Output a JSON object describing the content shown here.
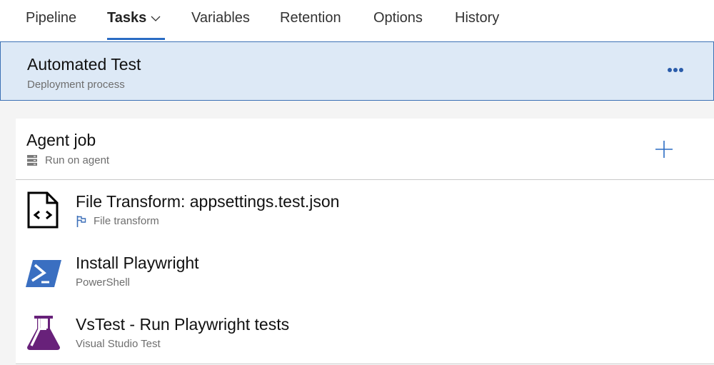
{
  "tabs": [
    {
      "label": "Pipeline",
      "active": false
    },
    {
      "label": "Tasks",
      "active": true,
      "has_dropdown": true
    },
    {
      "label": "Variables",
      "active": false
    },
    {
      "label": "Retention",
      "active": false
    },
    {
      "label": "Options",
      "active": false
    },
    {
      "label": "History",
      "active": false
    }
  ],
  "stage": {
    "title": "Automated Test",
    "subtitle": "Deployment process",
    "more_icon": "ellipsis-icon"
  },
  "job": {
    "title": "Agent job",
    "subtitle": "Run on agent",
    "icon": "server-icon",
    "add_icon": "plus-icon"
  },
  "tasks": [
    {
      "title": "File Transform: appsettings.test.json",
      "subtitle": "File transform",
      "icon": "code-file-icon",
      "sub_icon": "flag-icon"
    },
    {
      "title": "Install Playwright",
      "subtitle": "PowerShell",
      "icon": "powershell-icon"
    },
    {
      "title": "VsTest - Run Playwright tests",
      "subtitle": "Visual Studio Test",
      "icon": "flask-icon"
    }
  ],
  "colors": {
    "accent": "#2b6cc4",
    "stage_bg": "#dde9f6",
    "powershell": "#3a6fc1",
    "vstest": "#68217a"
  }
}
